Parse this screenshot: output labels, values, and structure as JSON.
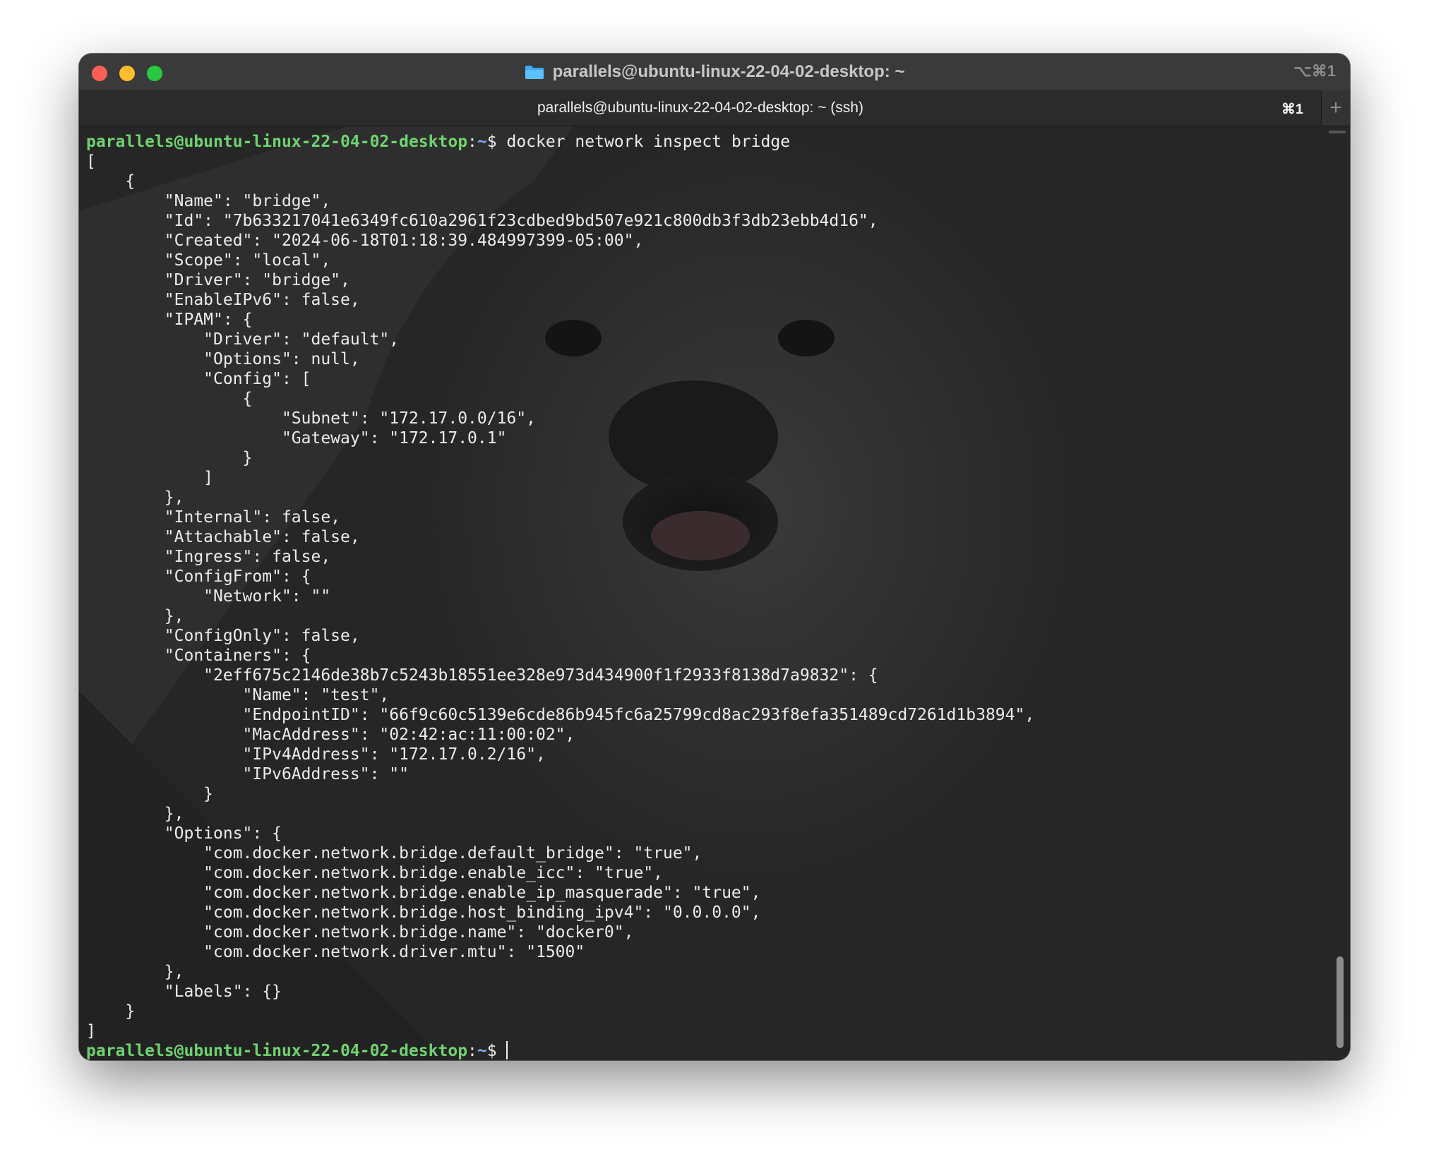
{
  "window": {
    "title": "parallels@ubuntu-linux-22-04-02-desktop: ~",
    "title_shortcut": "⌥⌘1",
    "folder_icon": "folder-icon"
  },
  "tab": {
    "label": "parallels@ubuntu-linux-22-04-02-desktop: ~ (ssh)",
    "shortcut": "⌘1",
    "new_tab_symbol": "+"
  },
  "terminal": {
    "prompt_user": "parallels@ubuntu-linux-22-04-02-desktop",
    "prompt_path": "~",
    "prompt_sep": ":",
    "prompt_suffix": "$ ",
    "command": "docker network inspect bridge",
    "output": "[\n    {\n        \"Name\": \"bridge\",\n        \"Id\": \"7b633217041e6349fc610a2961f23cdbed9bd507e921c800db3f3db23ebb4d16\",\n        \"Created\": \"2024-06-18T01:18:39.484997399-05:00\",\n        \"Scope\": \"local\",\n        \"Driver\": \"bridge\",\n        \"EnableIPv6\": false,\n        \"IPAM\": {\n            \"Driver\": \"default\",\n            \"Options\": null,\n            \"Config\": [\n                {\n                    \"Subnet\": \"172.17.0.0/16\",\n                    \"Gateway\": \"172.17.0.1\"\n                }\n            ]\n        },\n        \"Internal\": false,\n        \"Attachable\": false,\n        \"Ingress\": false,\n        \"ConfigFrom\": {\n            \"Network\": \"\"\n        },\n        \"ConfigOnly\": false,\n        \"Containers\": {\n            \"2eff675c2146de38b7c5243b18551ee328e973d434900f1f2933f8138d7a9832\": {\n                \"Name\": \"test\",\n                \"EndpointID\": \"66f9c60c5139e6cde86b945fc6a25799cd8ac293f8efa351489cd7261d1b3894\",\n                \"MacAddress\": \"02:42:ac:11:00:02\",\n                \"IPv4Address\": \"172.17.0.2/16\",\n                \"IPv6Address\": \"\"\n            }\n        },\n        \"Options\": {\n            \"com.docker.network.bridge.default_bridge\": \"true\",\n            \"com.docker.network.bridge.enable_icc\": \"true\",\n            \"com.docker.network.bridge.enable_ip_masquerade\": \"true\",\n            \"com.docker.network.bridge.host_binding_ipv4\": \"0.0.0.0\",\n            \"com.docker.network.bridge.name\": \"docker0\",\n            \"com.docker.network.driver.mtu\": \"1500\"\n        },\n        \"Labels\": {}\n    }\n]\n"
  },
  "colors": {
    "prompt_user": "#6fd36f",
    "prompt_path": "#8aa6ff",
    "text": "#ececec",
    "background": "#262626"
  }
}
